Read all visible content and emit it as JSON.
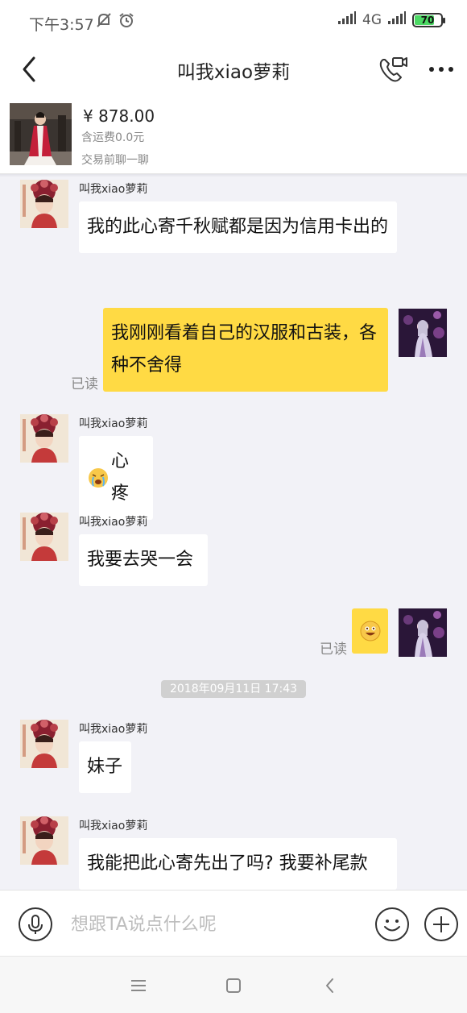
{
  "status_bar": {
    "time": "下午3:57",
    "network": "4G",
    "battery": "70",
    "icons": [
      "silent-bell-icon",
      "alarm-icon",
      "signal-icon",
      "signal-icon",
      "battery-icon"
    ]
  },
  "header": {
    "title": "叫我xiao萝莉",
    "icons": [
      "back-arrow-icon",
      "video-call-icon",
      "more-icon"
    ]
  },
  "product": {
    "price": "¥ 878.00",
    "shipping": "含运费0.0元",
    "note": "交易前聊一聊"
  },
  "messages": [
    {
      "side": "left",
      "sender": "叫我xiao萝莉",
      "text": "我的此心寄千秋赋都是因为信用卡出的"
    },
    {
      "side": "right",
      "text": "我刚刚看着自己的汉服和古装，各种不舍得",
      "status": "已读"
    },
    {
      "side": "left",
      "sender": "叫我xiao萝莉",
      "emoji": "crying-face-icon",
      "text": "心疼"
    },
    {
      "side": "left",
      "sender": "叫我xiao萝莉",
      "text": "我要去哭一会"
    },
    {
      "side": "right",
      "emoji": "grin-face-icon",
      "status": "已读"
    },
    {
      "type": "timestamp",
      "text": "2018年09月11日 17:43"
    },
    {
      "side": "left",
      "sender": "叫我xiao萝莉",
      "text": "妹子"
    },
    {
      "side": "left",
      "sender": "叫我xiao萝莉",
      "text": "我能把此心寄先出了吗? 我要补尾款"
    }
  ],
  "input": {
    "placeholder": "想跟TA说点什么呢",
    "icons": [
      "microphone-icon",
      "emoji-icon",
      "plus-icon"
    ]
  },
  "nav": {
    "icons": [
      "menu-icon",
      "home-icon",
      "back-icon"
    ]
  },
  "colors": {
    "accent_bubble": "#ffda44",
    "background": "#f2f2f7",
    "incoming_bubble": "#ffffff",
    "battery": "#4cd964"
  }
}
